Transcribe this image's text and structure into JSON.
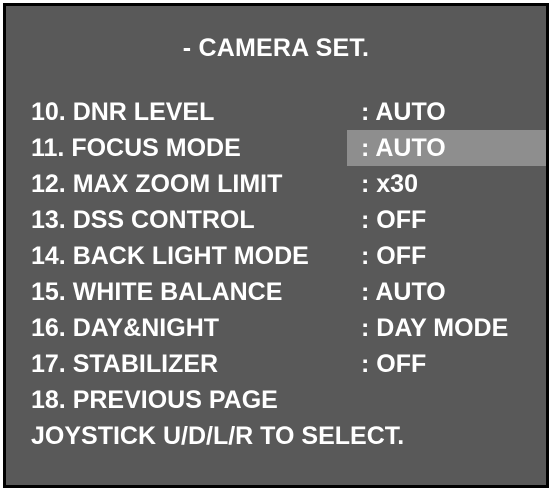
{
  "menu": {
    "title": "- CAMERA SET.",
    "selected_index": 1,
    "highlight_color": "#8e8e8e",
    "background_color": "#595959",
    "text_color": "#ffffff",
    "items": [
      {
        "label": "10. DNR LEVEL",
        "value": ": AUTO"
      },
      {
        "label": "11. FOCUS MODE",
        "value": ": AUTO"
      },
      {
        "label": "12. MAX ZOOM LIMIT",
        "value": ": x30"
      },
      {
        "label": "13. DSS CONTROL",
        "value": ": OFF"
      },
      {
        "label": "14. BACK LIGHT MODE",
        "value": ": OFF"
      },
      {
        "label": "15. WHITE BALANCE",
        "value": ": AUTO"
      },
      {
        "label": "16. DAY&NIGHT",
        "value": ": DAY MODE"
      },
      {
        "label": "17. STABILIZER",
        "value": ": OFF"
      },
      {
        "label": "18. PREVIOUS PAGE"
      }
    ],
    "footer": "JOYSTICK U/D/L/R TO SELECT."
  }
}
